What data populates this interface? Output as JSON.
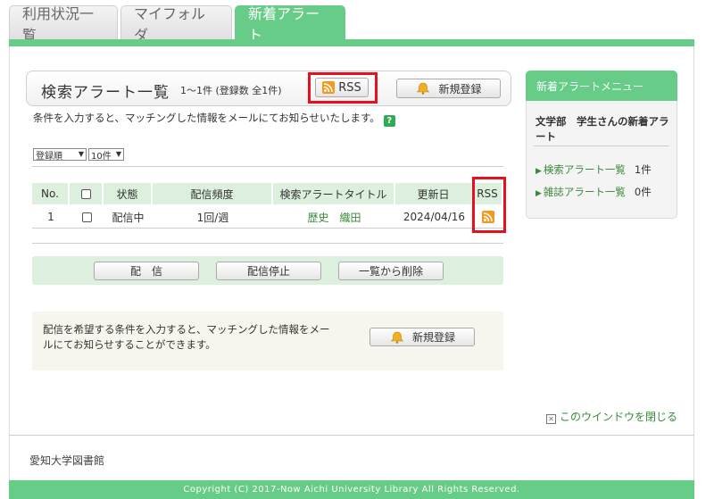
{
  "tabs": [
    {
      "label": "利用状況一覧"
    },
    {
      "label": "マイフォルダ"
    },
    {
      "label": "新着アラート"
    }
  ],
  "colors": {
    "accent": "#66cc88",
    "highlight": "#e8101e",
    "rss": "#f39a1e",
    "link": "#3a8a3a"
  },
  "main": {
    "title": "検索アラート一覧",
    "count": "1～1件 (登録数 全1件)",
    "rss_label": "RSS",
    "new_register_label": "新規登録",
    "description": "条件を入力すると、マッチングした情報をメールにてお知らせいたします。",
    "help_icon": "?",
    "sort_select": "登録順",
    "per_page_select": "10件",
    "table": {
      "headers": [
        "No.",
        "",
        "状態",
        "配信頻度",
        "検索アラートタイトル",
        "更新日",
        "RSS"
      ],
      "rows": [
        {
          "no": "1",
          "status": "配信中",
          "frequency": "1回/週",
          "title": "歴史　織田",
          "updated": "2024/04/16"
        }
      ]
    },
    "actions": {
      "deliver": "配　信",
      "stop": "配信停止",
      "delete": "一覧から削除"
    },
    "info_text": "配信を希望する条件を入力すると、マッチングした情報をメールにてお知らせすることができます。",
    "info_register_label": "新規登録"
  },
  "side": {
    "heading": "新着アラートメニュー",
    "user": "文学部　学生さんの新着アラート",
    "items": [
      {
        "label": "検索アラート一覧",
        "count": "1件"
      },
      {
        "label": "雑誌アラート一覧",
        "count": "0件"
      }
    ]
  },
  "close_label": "このウインドウを閉じる",
  "library": "愛知大学図書館",
  "footer": "Copyright (C) 2017-Now Aichi University Library All Rights Reserved."
}
